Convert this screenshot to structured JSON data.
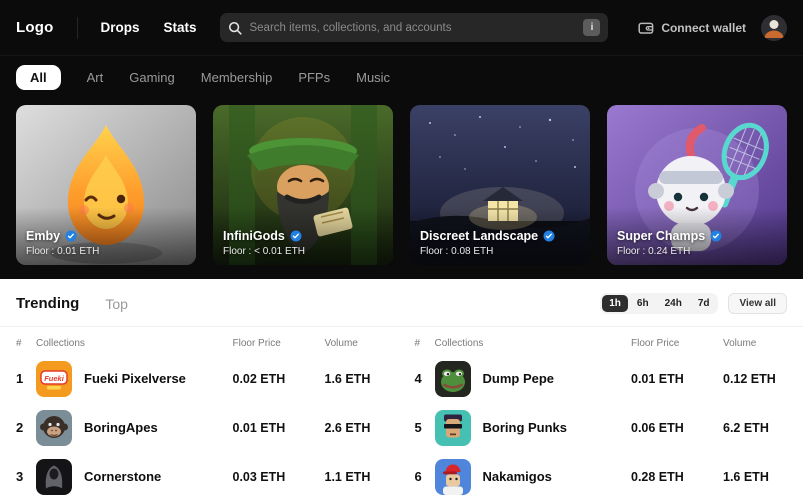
{
  "colors": {
    "accent_blue": "#2081e2",
    "topbar_bg": "#0b0b0b",
    "page_bg": "#ffffff"
  },
  "navbar": {
    "logo": "Logo",
    "links": [
      {
        "label": "Drops"
      },
      {
        "label": "Stats"
      }
    ],
    "search": {
      "placeholder": "Search items, collections, and accounts",
      "hint_key": "i"
    },
    "connect_wallet_label": "Connect wallet"
  },
  "category_tabs": [
    {
      "label": "All",
      "active": true
    },
    {
      "label": "Art",
      "active": false
    },
    {
      "label": "Gaming",
      "active": false
    },
    {
      "label": "Membership",
      "active": false
    },
    {
      "label": "PFPs",
      "active": false
    },
    {
      "label": "Music",
      "active": false
    }
  ],
  "featured_cards": [
    {
      "name": "Emby",
      "floor": "Floor : 0.01 ETH",
      "verified": true
    },
    {
      "name": "InfiniGods",
      "floor": "Floor : < 0.01 ETH",
      "verified": true
    },
    {
      "name": "Discreet Landscape",
      "floor": "Floor : 0.08 ETH",
      "verified": true
    },
    {
      "name": "Super Champs",
      "floor": "Floor : 0.24 ETH",
      "verified": true
    }
  ],
  "trending": {
    "tabs": [
      {
        "label": "Trending",
        "active": true
      },
      {
        "label": "Top",
        "active": false
      }
    ],
    "time_filters": [
      {
        "label": "1h",
        "active": true
      },
      {
        "label": "6h",
        "active": false
      },
      {
        "label": "24h",
        "active": false
      },
      {
        "label": "7d",
        "active": false
      }
    ],
    "view_all_label": "View all",
    "headers": {
      "rank": "#",
      "collections": "Collections",
      "floor_price": "Floor Price",
      "volume": "Volume"
    },
    "left_rows": [
      {
        "rank": "1",
        "name": "Fueki Pixelverse",
        "floor_price": "0.02 ETH",
        "volume": "1.6 ETH",
        "icon": "fueki-pixelverse-icon"
      },
      {
        "rank": "2",
        "name": "BoringApes",
        "floor_price": "0.01 ETH",
        "volume": "2.6 ETH",
        "icon": "boring-apes-icon"
      },
      {
        "rank": "3",
        "name": "Cornerstone",
        "floor_price": "0.03 ETH",
        "volume": "1.1 ETH",
        "icon": "cornerstone-icon"
      }
    ],
    "right_rows": [
      {
        "rank": "4",
        "name": "Dump Pepe",
        "floor_price": "0.01 ETH",
        "volume": "0.12 ETH",
        "icon": "dump-pepe-icon"
      },
      {
        "rank": "5",
        "name": "Boring Punks",
        "floor_price": "0.06 ETH",
        "volume": "6.2 ETH",
        "icon": "boring-punks-icon"
      },
      {
        "rank": "6",
        "name": "Nakamigos",
        "floor_price": "0.28 ETH",
        "volume": "1.6 ETH",
        "icon": "nakamigos-icon"
      }
    ]
  }
}
